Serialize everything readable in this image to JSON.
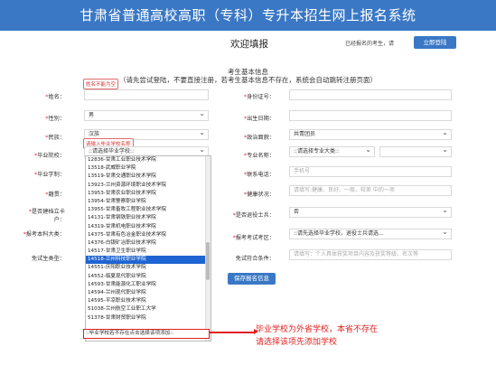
{
  "banner": {
    "title": "甘肃省普通高校高职（专科）专升本招生网上报名系统"
  },
  "welcome": {
    "title": "欢迎填报",
    "login_hint": "已经报名的考生，请",
    "login_button": "立即登陆"
  },
  "section": {
    "title": "考生基本信息",
    "subtitle": "（请先尝试登陆，不要直接注册，若考生基本信息不存在，系统会自动跳转注册页面）"
  },
  "form": {
    "name_label": "姓名：",
    "idno_label": "身份证号：",
    "gender_label": "性别：",
    "gender_value": "男",
    "birth_label": "出生日期：",
    "ethnic_label": "民族：",
    "ethnic_value": "汉族",
    "politic_label": "政治面貌：",
    "politic_value": "共青团员",
    "school_label": "毕业院校：",
    "school_value": "::请选择毕业学校::",
    "major_label": "专业名称：",
    "major_value": "::请选择专业大类::",
    "edu_label": "毕业学制：",
    "phone_label": "联系电话：",
    "phone_placeholder": "手机号",
    "origin_label": "籍贯：",
    "health_label": "健康状况：",
    "health_placeholder": "请填写:健康、良好、一般、较差 中的一项",
    "poor_label": "是否建档立卡户：",
    "veteran_label": "是否退役士兵：",
    "veteran_value": "否",
    "exam_type_label": "报考本科大类：",
    "exam_area_label": "报考考试考区：",
    "exam_area_value": "::请先选择毕业学校，退役士兵请选...",
    "exempt_label": "免试生类型：",
    "exempt_cond_label": "免试符合条件：",
    "exempt_cond_placeholder": "请填写：个人具体获奖项目内容及获奖等级、名次等",
    "submit_button": "保存报名信息"
  },
  "tips": {
    "name_tip": "姓名不能为空",
    "school_tip": "请输入毕业学校名称"
  },
  "dropdown": {
    "items": [
      "12836-甘肃工业职业技术学院",
      "13518-武威职业学院",
      "13519-甘肃交通职业技术学院",
      "13923-兰州资源环境职业技术学院",
      "13953-甘肃农业职业技术学院",
      "13954-甘肃警察职业学院",
      "13955-甘肃畜牧工程职业技术学院",
      "14131-甘肃钢铁职业技术学院",
      "14319-甘肃机电职业技术学院",
      "14375-甘肃有色冶金职业技术学院",
      "14376-白银矿冶职业技术学院",
      "14517-甘肃卫生职业学院",
      "14518-兰州科技职业学院",
      "14551-庆阳职业技术学院",
      "14552-临夏现代职业学院",
      "14593-甘肃能源化工职业学院",
      "14594-兰州现代职业学院",
      "14595-平凉职业技术学院",
      "51038-兰州航空工业职工大学",
      "51378-甘肃财贸职业学院"
    ],
    "selected_index": 12,
    "bottom_option": "::毕业学校若不存在点击选择该项添加::"
  },
  "annotation": {
    "line1": "毕业学校为外省学校，本省不存在",
    "line2": "请选择该项先添加学校"
  }
}
